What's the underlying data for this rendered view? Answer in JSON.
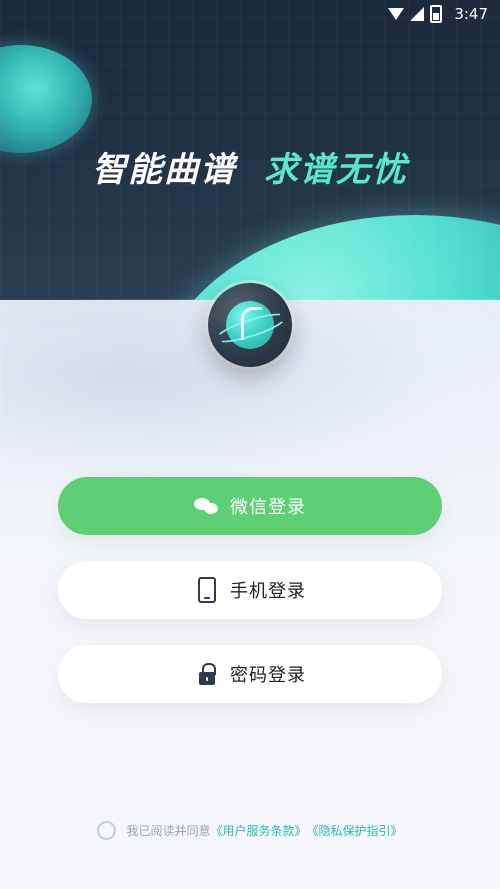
{
  "status_bar": {
    "time": "3:47",
    "icons": [
      "wifi-icon",
      "signal-icon",
      "battery-icon"
    ]
  },
  "hero": {
    "tagline_part1": "智能曲谱",
    "tagline_part2": "求谱无忧",
    "colors": {
      "background_top": "#1b2a3c",
      "accent_teal": "#59e6d2"
    }
  },
  "buttons": {
    "wechat": {
      "label": "微信登录",
      "icon": "wechat-icon",
      "color": "#5ecf74"
    },
    "phone": {
      "label": "手机登录",
      "icon": "phone-icon"
    },
    "password": {
      "label": "密码登录",
      "icon": "lock-icon"
    }
  },
  "agreement": {
    "prefix": "我已阅读并同意",
    "terms_link": "《用户服务条款》",
    "privacy_link": "《隐私保护指引》"
  }
}
